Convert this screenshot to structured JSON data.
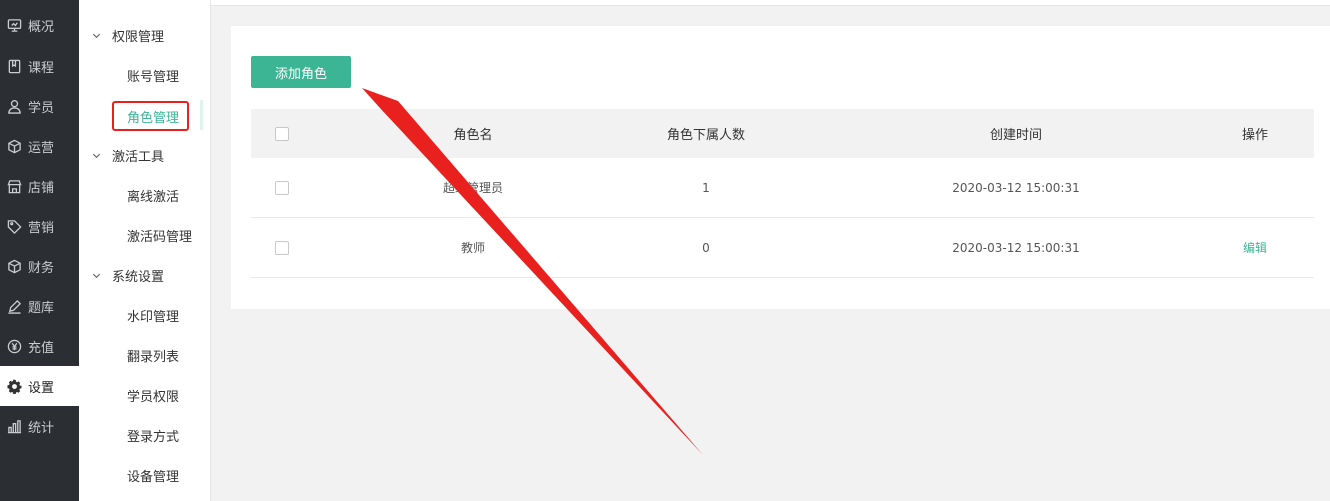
{
  "nav": {
    "items": [
      {
        "label": "概况",
        "icon": "monitor-icon"
      },
      {
        "label": "课程",
        "icon": "book-icon"
      },
      {
        "label": "学员",
        "icon": "user-icon"
      },
      {
        "label": "运营",
        "icon": "cube-icon"
      },
      {
        "label": "店铺",
        "icon": "shop-icon"
      },
      {
        "label": "营销",
        "icon": "tag-icon"
      },
      {
        "label": "财务",
        "icon": "box-icon"
      },
      {
        "label": "题库",
        "icon": "pencil-icon"
      },
      {
        "label": "充值",
        "icon": "yen-icon"
      },
      {
        "label": "设置",
        "icon": "gear-icon",
        "active": true
      },
      {
        "label": "统计",
        "icon": "bar-chart-icon"
      }
    ]
  },
  "submenu": {
    "groups": [
      {
        "label": "权限管理",
        "items": [
          "账号管理",
          "角色管理"
        ]
      },
      {
        "label": "激活工具",
        "items": [
          "离线激活",
          "激活码管理"
        ]
      },
      {
        "label": "系统设置",
        "items": [
          "水印管理",
          "翻录列表",
          "学员权限",
          "登录方式",
          "设备管理"
        ]
      }
    ],
    "active_item": "角色管理"
  },
  "toolbar": {
    "add_role_label": "添加角色"
  },
  "table": {
    "headers": {
      "name": "角色名",
      "count": "角色下属人数",
      "created": "创建时间",
      "action": "操作"
    },
    "rows": [
      {
        "name": "超级管理员",
        "count": "1",
        "created": "2020-03-12 15:00:31",
        "action": ""
      },
      {
        "name": "教师",
        "count": "0",
        "created": "2020-03-12 15:00:31",
        "action": "编辑"
      }
    ]
  },
  "colors": {
    "accent": "#3cb595",
    "nav_bg": "#2b2f34",
    "annotation": "#e8211e"
  }
}
